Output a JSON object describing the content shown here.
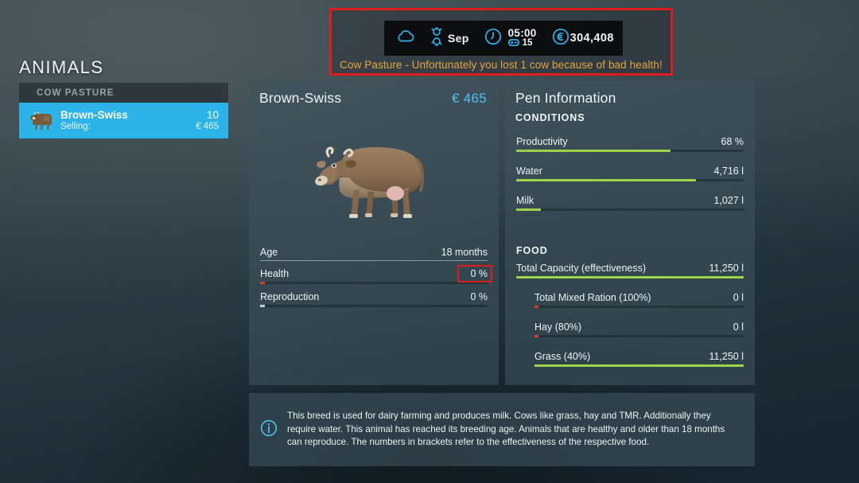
{
  "hud": {
    "weather_icon": "cloud-icon",
    "season_icon": "season-icon",
    "month": "Sep",
    "clock_icon": "clock-icon",
    "time": "05:00",
    "speed_icon": "time-scale-icon",
    "day": "15",
    "currency_icon": "euro-circle-icon",
    "money": "304,408",
    "message": "Cow Pasture - Unfortunately you lost 1 cow because of bad health!"
  },
  "sidebar": {
    "title": "ANIMALS",
    "group_label": "COW PASTURE",
    "item": {
      "icon": "cow-icon",
      "name": "Brown-Swiss",
      "count": "10",
      "sub_label": "Selling:",
      "sub_value": "€ 465"
    }
  },
  "animal_panel": {
    "title": "Brown-Swiss",
    "price": "€ 465",
    "image": "cow-image",
    "stats": [
      {
        "label": "Age",
        "value": "18 months",
        "type": "rule",
        "fill": 0,
        "color": ""
      },
      {
        "label": "Health",
        "value": "0 %",
        "type": "bar",
        "fill": 2,
        "color": "red",
        "highlight": true
      },
      {
        "label": "Reproduction",
        "value": "0 %",
        "type": "bar",
        "fill": 2,
        "color": "grey",
        "highlight": false
      }
    ]
  },
  "pen_panel": {
    "title": "Pen Information",
    "conditions_head": "CONDITIONS",
    "conditions": [
      {
        "label": "Productivity",
        "value": "68 %",
        "fill": 68
      },
      {
        "label": "Water",
        "value": "4,716 l",
        "fill": 79
      },
      {
        "label": "Milk",
        "value": "1,027 l",
        "fill": 11
      }
    ],
    "food_head": "FOOD",
    "food": [
      {
        "label": "Total Capacity (effectiveness)",
        "value": "11,250 l",
        "fill": 100,
        "indent": false,
        "color": ""
      },
      {
        "label": "Total Mixed Ration (100%)",
        "value": "0 l",
        "fill": 2,
        "indent": true,
        "color": "red"
      },
      {
        "label": "Hay (80%)",
        "value": "0 l",
        "fill": 2,
        "indent": true,
        "color": "red"
      },
      {
        "label": "Grass (40%)",
        "value": "11,250 l",
        "fill": 100,
        "indent": true,
        "color": ""
      }
    ]
  },
  "info_panel": {
    "icon": "info-icon",
    "text": "This breed is used for dairy farming and produces milk. Cows like grass, hay and TMR. Additionally they require water. This animal has reached its breeding age. Animals that are healthy and older than 18 months can reproduce. The numbers in brackets refer to the effectiveness of the respective food."
  },
  "colors": {
    "accent_blue": "#2cb3e8",
    "bar_green": "#9bd44a",
    "bar_red": "#e03a2a",
    "warning_orange": "#e8a33d",
    "highlight_red": "#e01b1b"
  }
}
